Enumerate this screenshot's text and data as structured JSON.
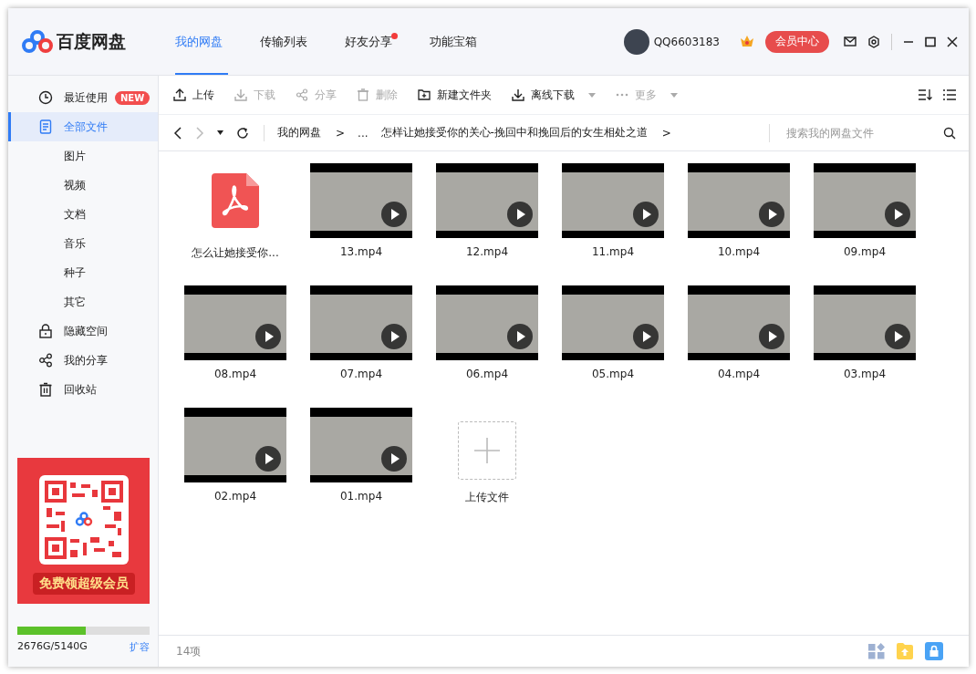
{
  "app": {
    "name": "百度网盘"
  },
  "tabs": [
    {
      "label": "我的网盘",
      "selected": true,
      "dot": false
    },
    {
      "label": "传输列表",
      "selected": false,
      "dot": false
    },
    {
      "label": "好友分享",
      "selected": false,
      "dot": true
    },
    {
      "label": "功能宝箱",
      "selected": false,
      "dot": false
    }
  ],
  "user": {
    "name": "QQ6603183",
    "vip_button": "会员中心"
  },
  "sidebar": {
    "items": [
      {
        "label": "最近使用",
        "badge": "NEW",
        "selected": false
      },
      {
        "label": "全部文件",
        "selected": true,
        "children": [
          {
            "label": "图片",
            "selected": false
          },
          {
            "label": "视频",
            "selected": false
          },
          {
            "label": "文档",
            "selected": false
          },
          {
            "label": "音乐",
            "selected": false
          },
          {
            "label": "种子",
            "selected": false
          },
          {
            "label": "其它",
            "selected": false
          }
        ]
      },
      {
        "label": "隐藏空间",
        "selected": false
      },
      {
        "label": "我的分享",
        "selected": false
      },
      {
        "label": "回收站",
        "selected": false
      }
    ],
    "promo": {
      "label": "免费领超级会员"
    },
    "storage": {
      "level": 0.52,
      "reading": "2676G/5140G",
      "expand_link": "扩容"
    }
  },
  "toolbar": [
    {
      "label": "上传",
      "disabled": false,
      "dropdown": false
    },
    {
      "label": "下载",
      "disabled": true,
      "dropdown": false
    },
    {
      "label": "分享",
      "disabled": true,
      "dropdown": false
    },
    {
      "label": "删除",
      "disabled": true,
      "dropdown": false
    },
    {
      "label": "新建文件夹",
      "disabled": false,
      "dropdown": false
    },
    {
      "label": "离线下载",
      "disabled": false,
      "dropdown": true
    },
    {
      "label": "更多",
      "disabled": true,
      "dropdown": true
    }
  ],
  "breadcrumb": {
    "forward_disabled": true,
    "items": [
      {
        "label": "我的网盘",
        "separator": ">"
      },
      {
        "label": "..."
      },
      {
        "label": "怎样让她接受你的关心-挽回中和挽回后的女生相处之道",
        "separator": ">"
      }
    ],
    "search": {
      "placeholder": "搜索我的网盘文件"
    }
  },
  "files": [
    {
      "name": "怎么让她接受你...",
      "kind": "pdf"
    },
    {
      "name": "13.mp4",
      "kind": "video"
    },
    {
      "name": "12.mp4",
      "kind": "video"
    },
    {
      "name": "11.mp4",
      "kind": "video"
    },
    {
      "name": "10.mp4",
      "kind": "video"
    },
    {
      "name": "09.mp4",
      "kind": "video"
    },
    {
      "name": "08.mp4",
      "kind": "video"
    },
    {
      "name": "07.mp4",
      "kind": "video"
    },
    {
      "name": "06.mp4",
      "kind": "video"
    },
    {
      "name": "05.mp4",
      "kind": "video"
    },
    {
      "name": "04.mp4",
      "kind": "video"
    },
    {
      "name": "03.mp4",
      "kind": "video"
    },
    {
      "name": "02.mp4",
      "kind": "video"
    },
    {
      "name": "01.mp4",
      "kind": "video"
    },
    {
      "name": "上传文件",
      "kind": "upload"
    }
  ],
  "status_bar": {
    "count": "14项"
  }
}
